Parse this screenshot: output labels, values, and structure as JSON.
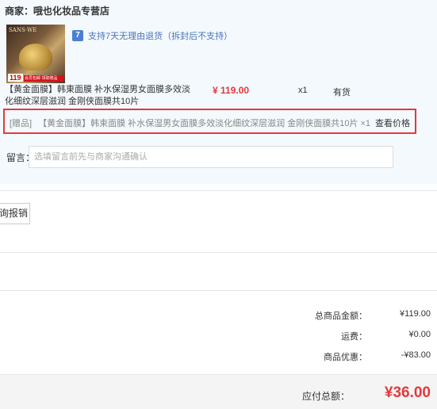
{
  "shop": {
    "label": "商家：哦也化妆品专营店"
  },
  "service": {
    "badge": "7",
    "text": "支持7天无理由退货（拆封后不支持）"
  },
  "product": {
    "thumb_brand": "SANS·WE",
    "thumb_price": "119",
    "thumb_strip": "会员包邮 领取赠品",
    "title": "【黄金面膜】韩東面膜 补水保湿男女面膜多效淡化细纹深层滋润 金刚侠面膜共10片",
    "price": "¥ 119.00",
    "qty": "x1",
    "stock": "有货"
  },
  "gift": {
    "tag": "[赠品]",
    "name": "【黄金面膜】韩束面膜 补水保湿男女面膜多效淡化细纹深层滋润 金刚侠面膜共10片",
    "times": "×1",
    "check_price": "查看价格"
  },
  "remark": {
    "label": "留言：",
    "placeholder": "选填留言前先与商家沟通确认"
  },
  "report": {
    "label": "询报销"
  },
  "summary": {
    "goods_label": "总商品金额：",
    "goods_value": "¥119.00",
    "shipping_label": "运费：",
    "shipping_value": "¥0.00",
    "discount_label": "商品优惠：",
    "discount_value": "-¥83.00"
  },
  "total": {
    "label": "应付总额：",
    "value": "¥36.00"
  },
  "colors": {
    "accent_red": "#e4393c",
    "panel_bg": "#f3f9fd",
    "service_blue": "#4b73b8"
  }
}
